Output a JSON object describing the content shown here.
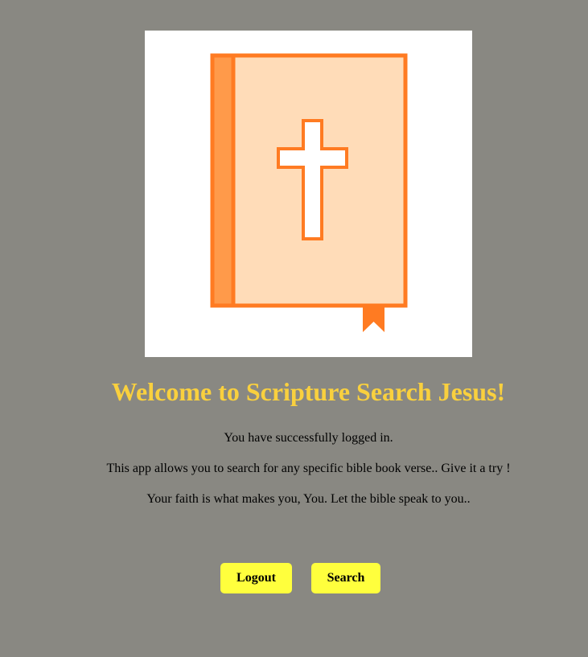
{
  "logo": {
    "icon": "bible-book-icon",
    "colors": {
      "cover": "#ffdcb8",
      "spine": "#ff9a4a",
      "outline": "#ff7b22",
      "cross": "#ffffff"
    }
  },
  "title": "Welcome to Scripture Search Jesus!",
  "messages": {
    "logged_in": "You have successfully logged in.",
    "description": "This app allows you to search for any specific bible book verse.. Give it a try !",
    "faith": "Your faith is what makes you, You. Let the bible speak to you.."
  },
  "buttons": {
    "logout": "Logout",
    "search": "Search"
  },
  "colors": {
    "background": "#898882",
    "title": "#f9d03e",
    "button": "#ffff3d"
  }
}
